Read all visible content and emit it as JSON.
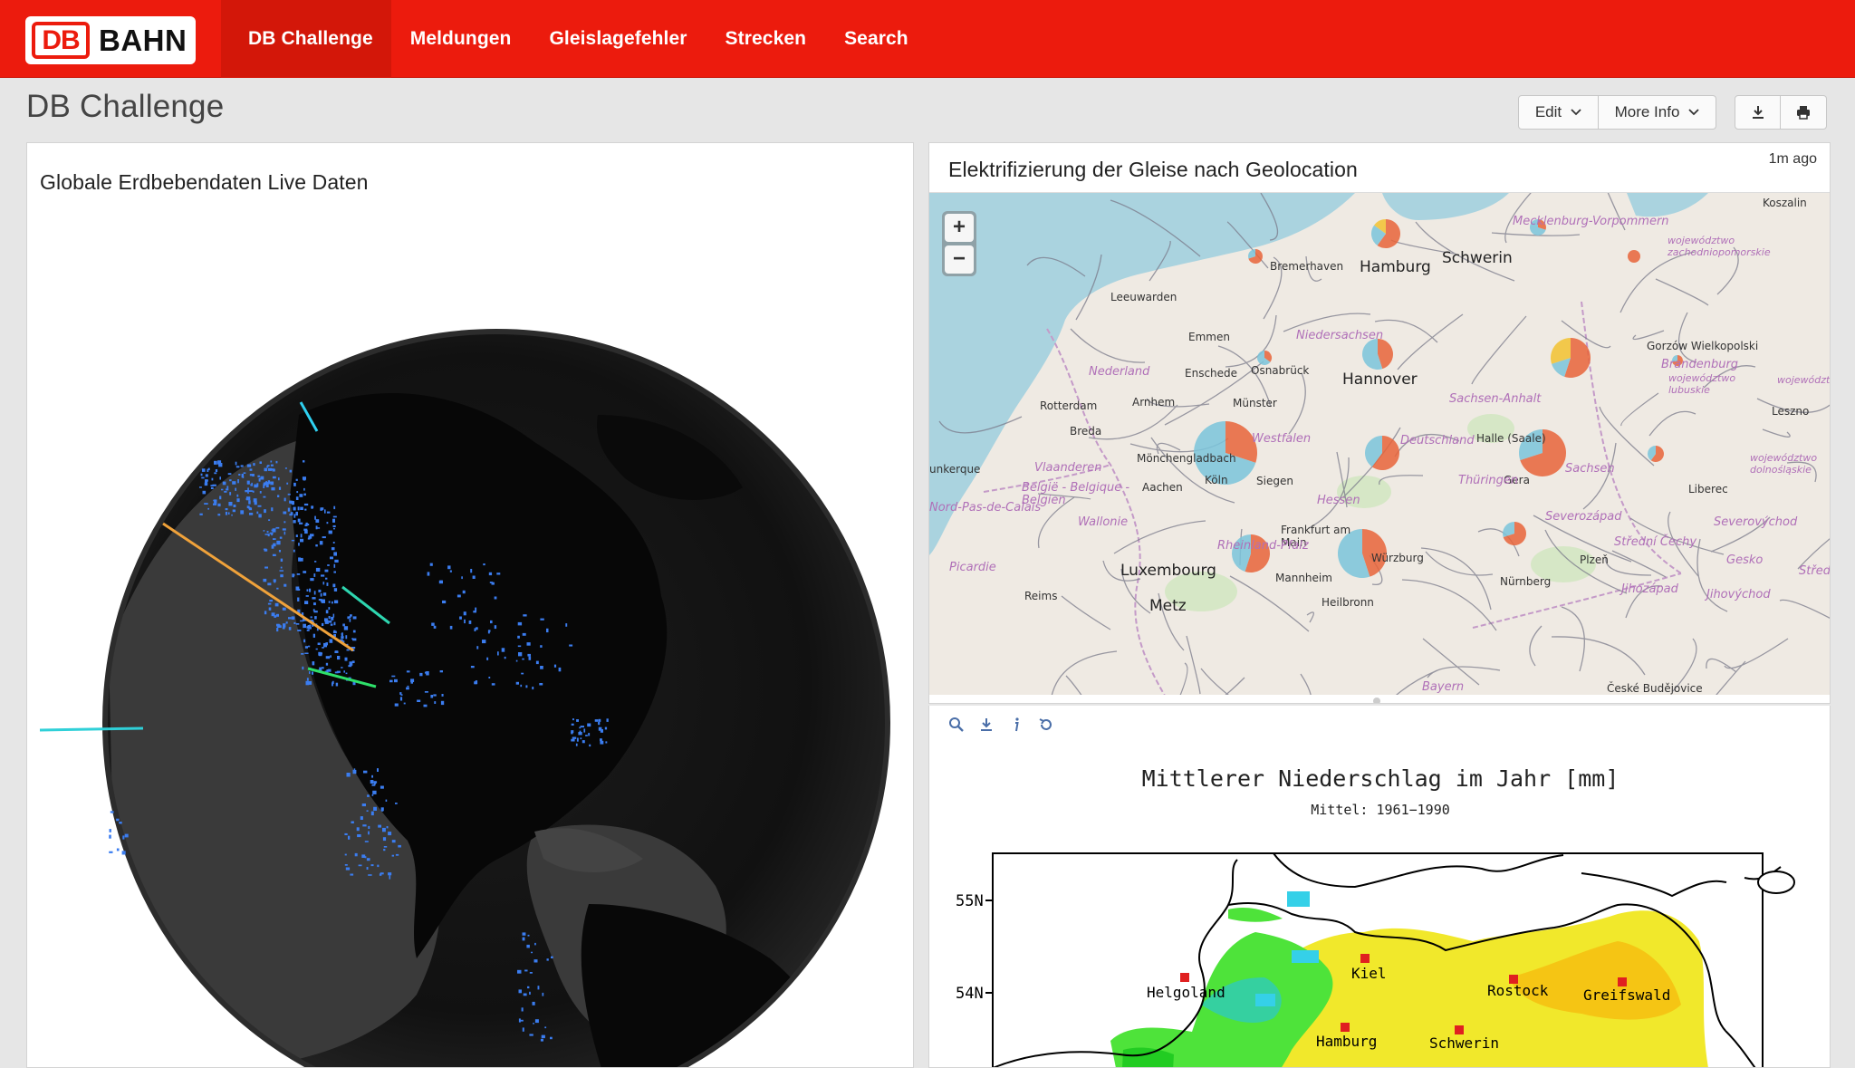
{
  "brand": {
    "logo_mark": "DB",
    "logo_text": "BAHN"
  },
  "nav": {
    "items": [
      {
        "label": "DB Challenge",
        "active": true
      },
      {
        "label": "Meldungen"
      },
      {
        "label": "Gleislagefehler"
      },
      {
        "label": "Strecken"
      },
      {
        "label": "Search"
      }
    ]
  },
  "page": {
    "title": "DB Challenge"
  },
  "toolbar": {
    "edit_label": "Edit",
    "more_info_label": "More Info",
    "download_icon": "download-icon",
    "print_icon": "print-icon"
  },
  "panels": {
    "earthquake": {
      "title": "Globale Erdbebendaten Live Daten"
    },
    "electrification": {
      "title": "Elektrifizierung der Gleise nach Geolocation",
      "timestamp": "1m ago",
      "zoom_in": "+",
      "zoom_out": "−",
      "labels": [
        "Hamburg",
        "Schwerin",
        "Bremerhaven",
        "Koszalin",
        "Leeuwarden",
        "Emmen",
        "Hannover",
        "Nederland",
        "Enschede",
        "Osnabrück",
        "Rotterdam",
        "Arnhem",
        "Münster",
        "Breda",
        "Mönchengladbach",
        "Köln",
        "Aachen",
        "Siegen",
        "België - Belgique - Belgien",
        "Wallonie",
        "Luxembourg",
        "Metz",
        "Reims",
        "Frankfurt am Main",
        "Mannheim",
        "Heilbronn",
        "Würzburg",
        "Nürnberg",
        "Plzeň",
        "Halle (Saale)",
        "Gera",
        "Sachsen",
        "Thüringen",
        "Hessen",
        "Westfalen",
        "Deutschland",
        "Niedersachsen",
        "Sachsen-Anhalt",
        "Brandenburg",
        "Mecklenburg-Vorpommern",
        "Gorzów Wielkopolski",
        "Leszno",
        "Liberec",
        "Vlaanderen",
        "Picardie",
        "Severozápad",
        "Střední Čechy",
        "Jihozápad",
        "Jihovýchod",
        "Gesko",
        "Severovýchod",
        "województwo zachodniopomorskie",
        "województwo lubuskie",
        "województwo dolnośląskie",
        "Rheinland-Pfalz",
        "Nord-Pas-de-Calais",
        "unkerque",
        "Bayern",
        "České Budějovice",
        "Střední",
        "województwo wielkop"
      ]
    },
    "rain": {
      "tools": [
        "zoom-icon",
        "download-icon",
        "info-icon",
        "reset-icon"
      ],
      "title": "Mittlerer Niederschlag im Jahr [mm]",
      "subtitle": "Mittel: 1961−1990",
      "ytick_55": "55N",
      "ytick_54": "54N",
      "cities": [
        "Kiel",
        "Helgoland",
        "Rostock",
        "Greifswald",
        "Hamburg",
        "Schwerin"
      ]
    }
  },
  "colors": {
    "brand_red": "#ec1b0d",
    "pie_red": "#e8643a",
    "pie_blue": "#7ac4db",
    "pie_yellow": "#f2c230"
  }
}
